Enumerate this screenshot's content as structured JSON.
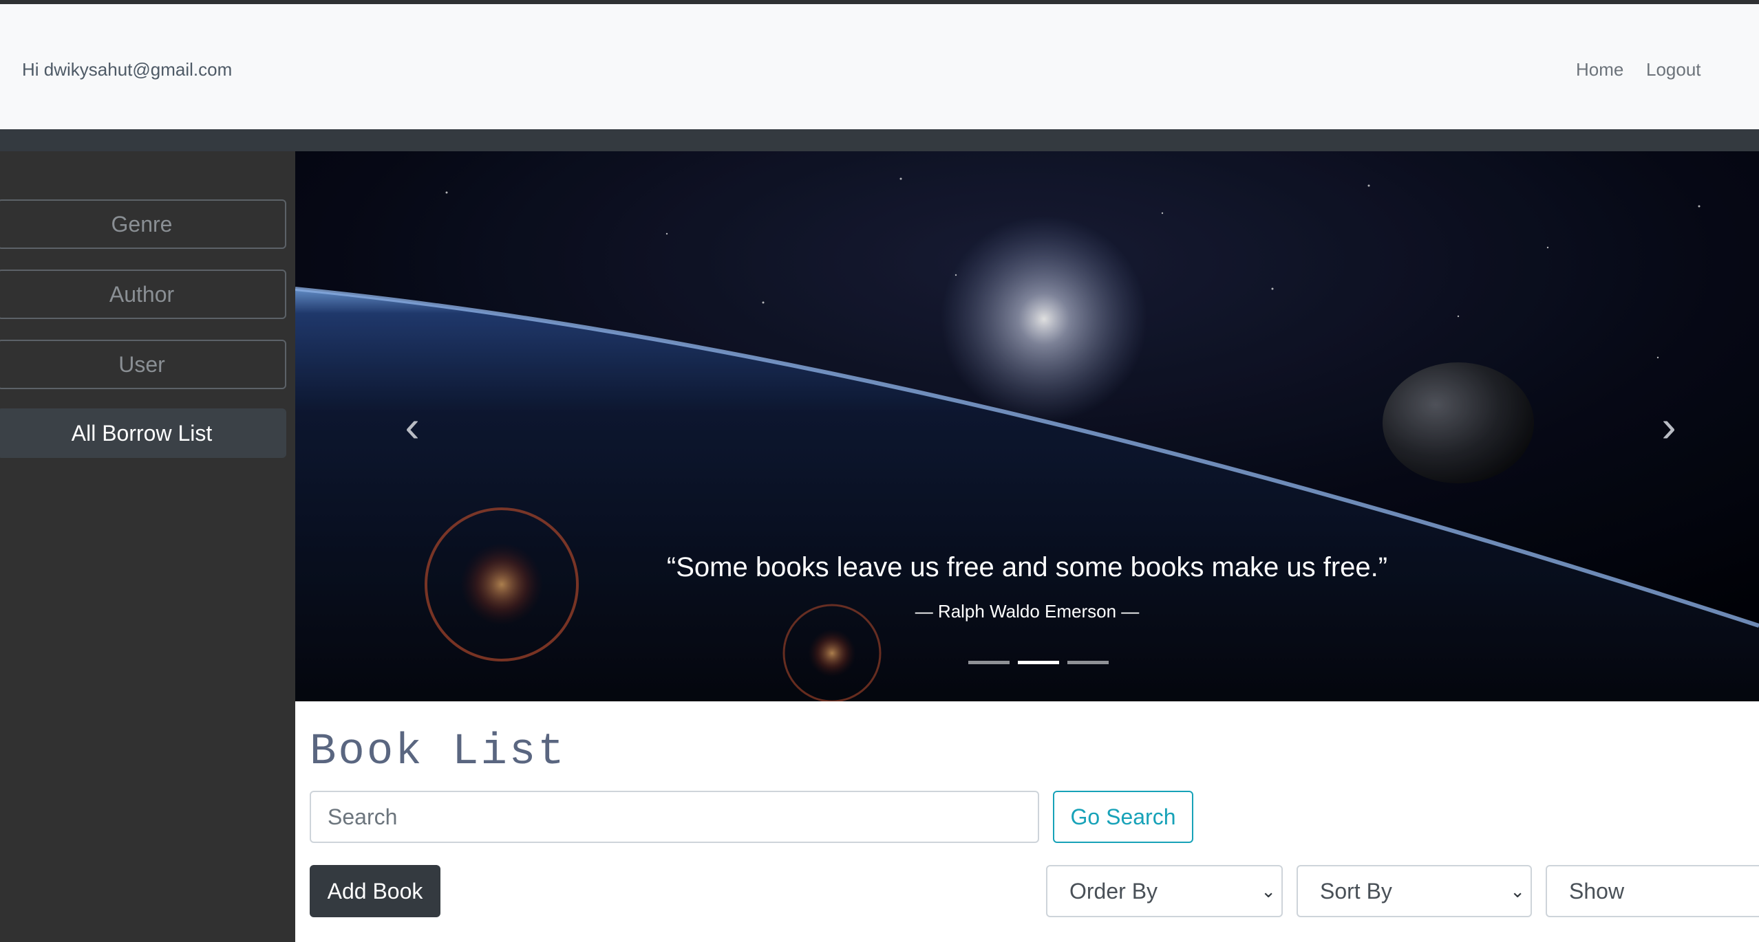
{
  "navbar": {
    "greeting": "Hi dwikysahut@gmail.com",
    "links": {
      "home": "Home",
      "logout": "Logout"
    }
  },
  "sidebar": {
    "items": [
      {
        "label": "Genre",
        "active": false
      },
      {
        "label": "Author",
        "active": false
      },
      {
        "label": "User",
        "active": false
      },
      {
        "label": "All Borrow List",
        "active": true
      }
    ]
  },
  "carousel": {
    "quote": "“Some books leave us free and some books make us free.”",
    "author": "— Ralph Waldo Emerson —",
    "slide_count": 3,
    "active_slide": 2,
    "prev_icon": "chevron-left-icon",
    "next_icon": "chevron-right-icon"
  },
  "main": {
    "title": "Book List",
    "search": {
      "placeholder": "Search",
      "value": ""
    },
    "go_search_label": "Go Search",
    "add_book_label": "Add Book",
    "selects": {
      "order_by": "Order By",
      "sort_by": "Sort By",
      "show": "Show"
    }
  },
  "colors": {
    "navbar_bg": "#f8f9fa",
    "sidebar_bg": "#313131",
    "accent_info": "#17a2b8",
    "dark_button": "#343a40",
    "title_color": "#5a6680"
  }
}
